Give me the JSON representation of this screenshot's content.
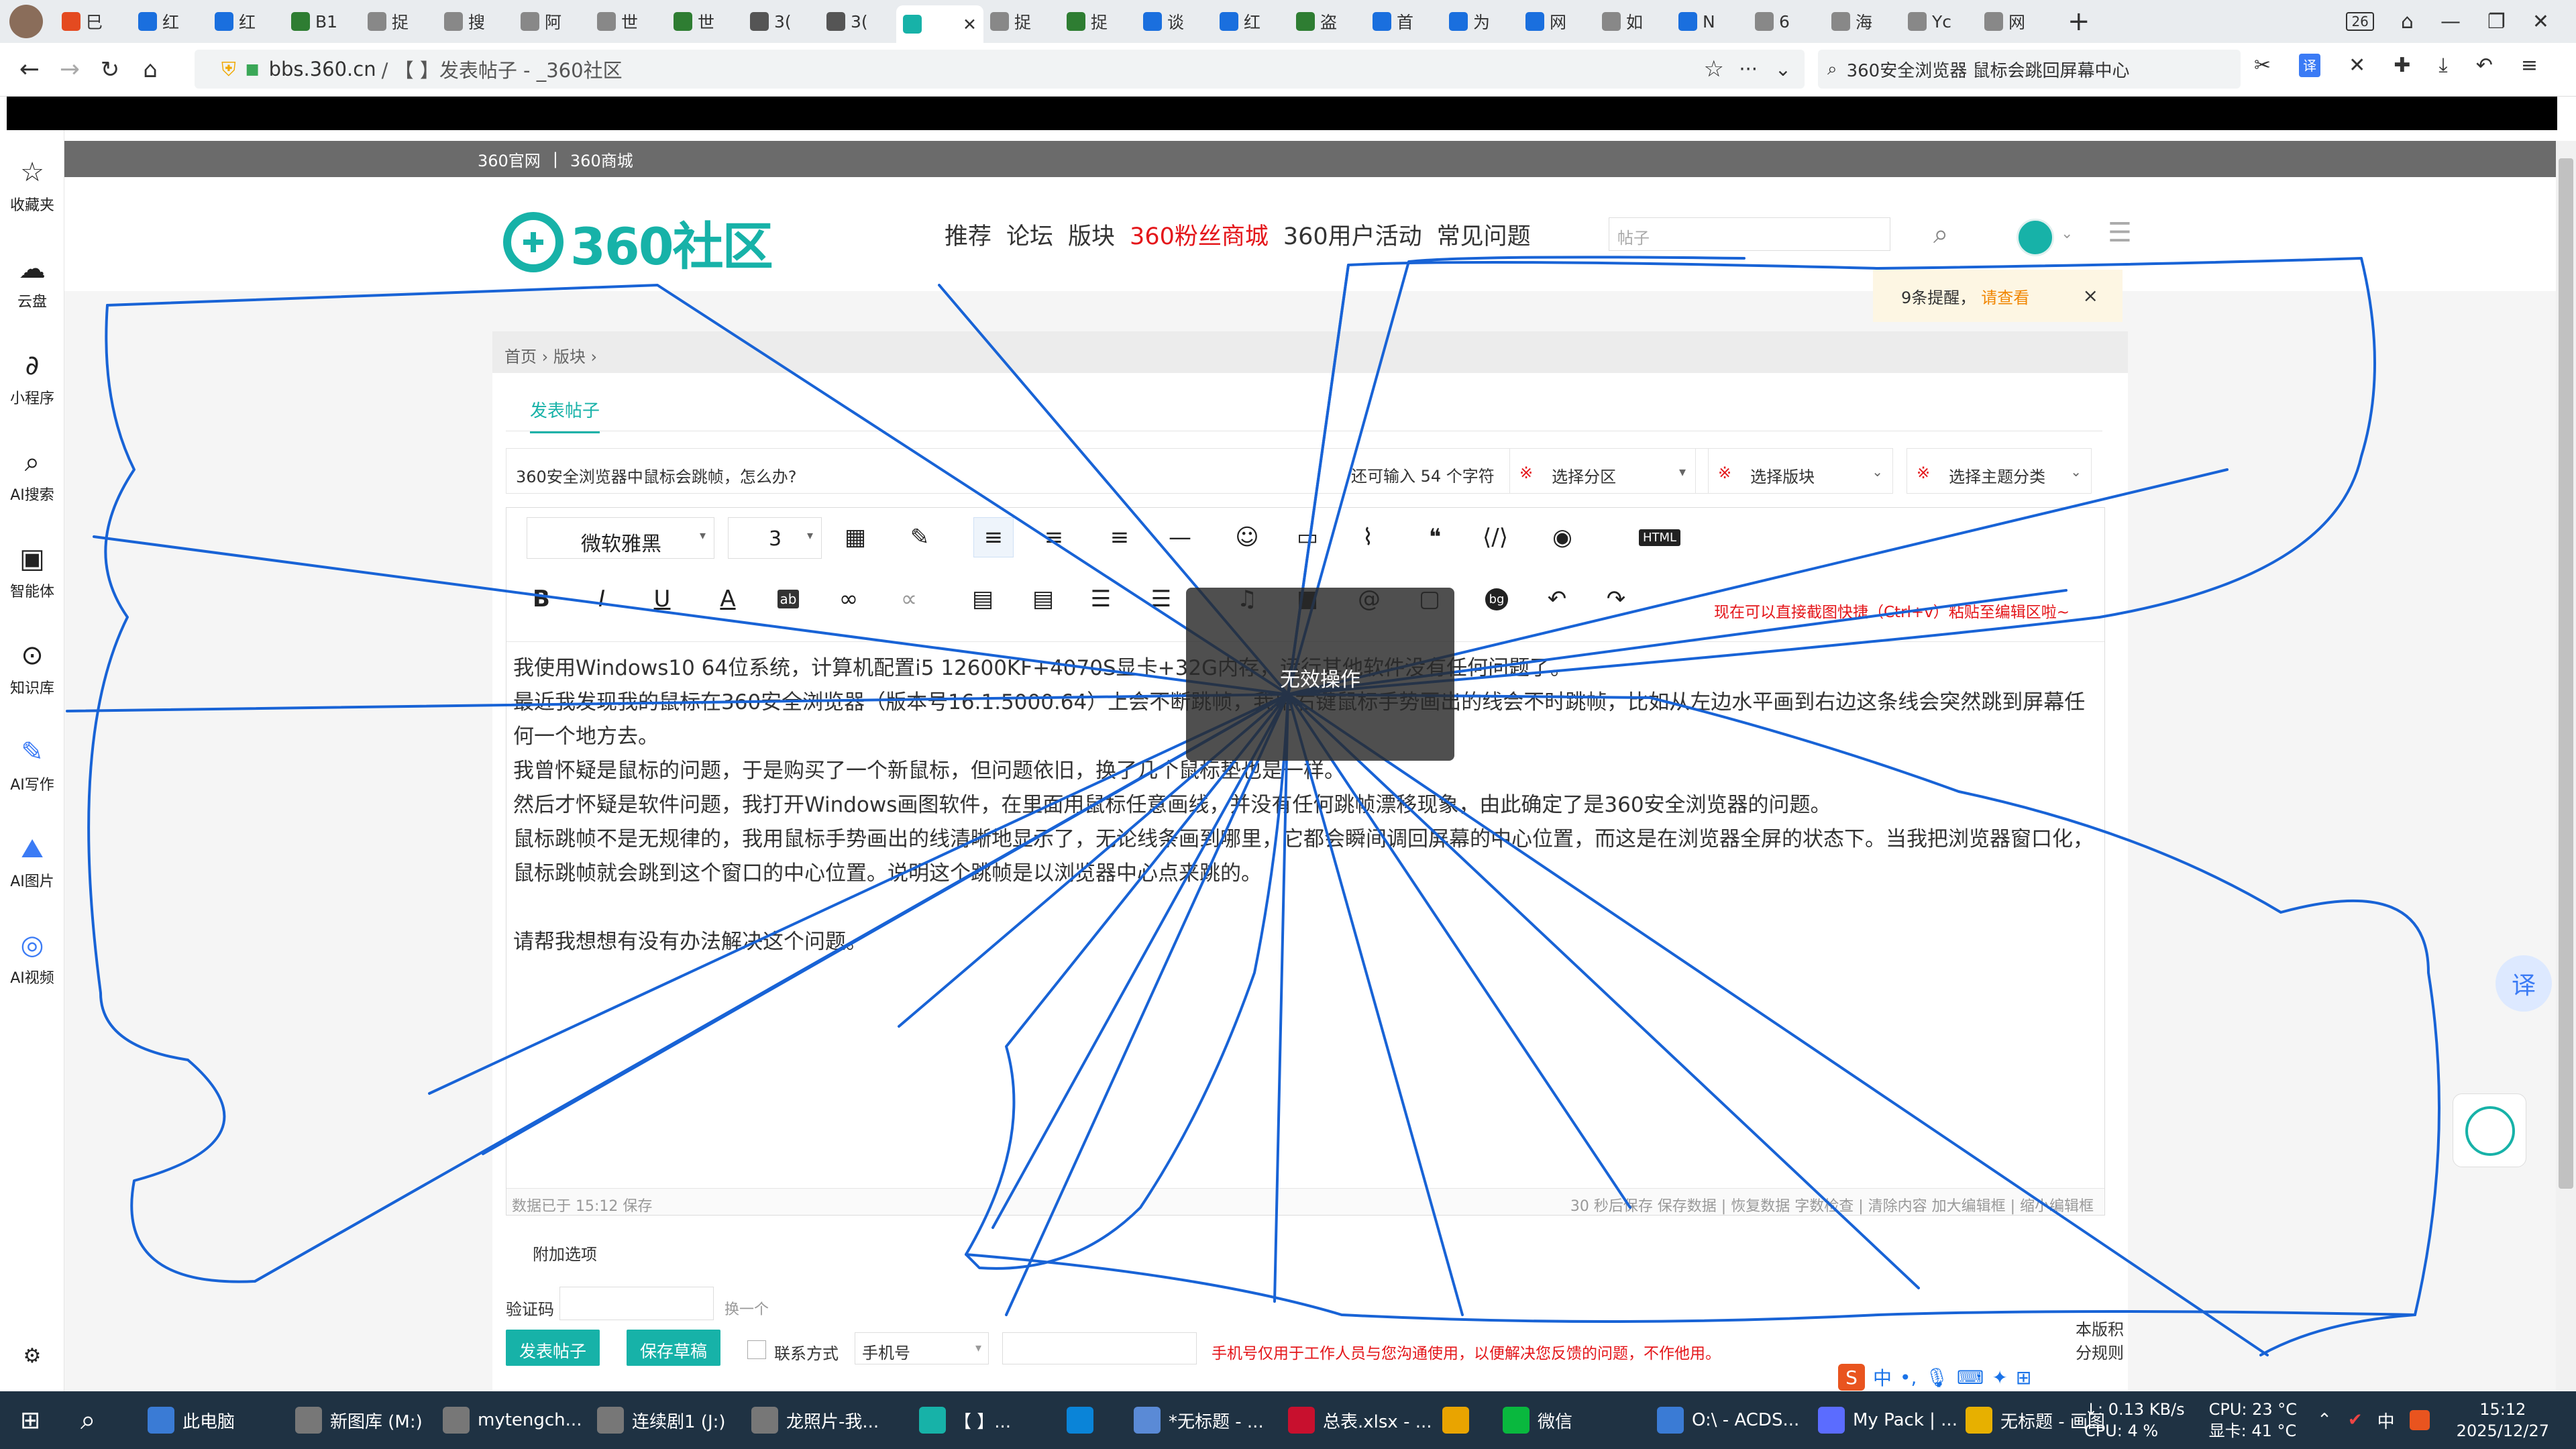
{
  "tabs": [
    {
      "label": "巳",
      "color": "#e44a20"
    },
    {
      "label": "红",
      "color": "#1a6fde"
    },
    {
      "label": "红",
      "color": "#1a6fde"
    },
    {
      "label": "B1",
      "color": "#2e7d32"
    },
    {
      "label": "捉",
      "color": "#888888"
    },
    {
      "label": "搜",
      "color": "#888888"
    },
    {
      "label": "阿",
      "color": "#888888"
    },
    {
      "label": "世",
      "color": "#888888"
    },
    {
      "label": "世",
      "color": "#2e7d32"
    },
    {
      "label": "3(",
      "color": "#555555"
    },
    {
      "label": "3(",
      "color": "#555555"
    },
    {
      "label": "",
      "color": "#17b2a8",
      "active": true
    },
    {
      "label": "捉",
      "color": "#888888"
    },
    {
      "label": "捉",
      "color": "#2e7d32"
    },
    {
      "label": "谈",
      "color": "#1a6fde"
    },
    {
      "label": "红",
      "color": "#1a6fde"
    },
    {
      "label": "盗",
      "color": "#2e7d32"
    },
    {
      "label": "首",
      "color": "#1a6fde"
    },
    {
      "label": "为",
      "color": "#1a6fde"
    },
    {
      "label": "网",
      "color": "#1a6fde"
    },
    {
      "label": "如",
      "color": "#888888"
    },
    {
      "label": "N",
      "color": "#1a6fde"
    },
    {
      "label": "6",
      "color": "#888888"
    },
    {
      "label": "海",
      "color": "#888888"
    },
    {
      "label": "Yc",
      "color": "#888888"
    },
    {
      "label": "网",
      "color": "#888888"
    }
  ],
  "tab_count": "26",
  "url": {
    "domain": "bbs.360.cn",
    "path": "/ 【          】发表帖子 - _360社区"
  },
  "search_box": "360安全浏览器 鼠标会跳回屏幕中心",
  "sidebar": [
    {
      "label": "收藏夹",
      "icon": "star-icon"
    },
    {
      "label": "云盘",
      "icon": "cloud-icon"
    },
    {
      "label": "小程序",
      "icon": "link-icon"
    },
    {
      "label": "AI搜索",
      "icon": "search-icon"
    },
    {
      "label": "智能体",
      "icon": "robot-icon"
    },
    {
      "label": "知识库",
      "icon": "knowledge-icon"
    },
    {
      "label": "AI写作",
      "icon": "pen-icon"
    },
    {
      "label": "AI图片",
      "icon": "image-icon"
    },
    {
      "label": "AI视频",
      "icon": "video-icon"
    }
  ],
  "topstrip": {
    "a": "360官网",
    "sep": "|",
    "b": "360商城"
  },
  "logo": "360社区",
  "nav": [
    "推荐",
    "论坛",
    "版块",
    "360粉丝商城",
    "360用户活动",
    "常见问题"
  ],
  "header_search_placeholder": "帖子",
  "notice": {
    "text": "9条提醒，",
    "link": "请查看",
    "close": "×"
  },
  "breadcrumb": "首页 › 版块 ›",
  "post_tab": "发表帖子",
  "title_value": "360安全浏览器中鼠标会跳帧，怎么办?",
  "remaining": "还可输入 54 个字符",
  "selects": [
    "选择分区",
    "选择版块",
    "选择主题分类"
  ],
  "font": "微软雅黑",
  "fontsize": "3",
  "html_btn": "HTML",
  "paste_hint": "现在可以直接截图快捷（Ctrl+v）粘贴至编辑区啦~",
  "body": [
    "我使用Windows10 64位系统，计算机配置i5 12600KF+4070S显卡+32G内存，运行其他软件没有任何问题了。",
    "最近我发现我的鼠标在360安全浏览器（版本号16.1.5000.64）上会不断跳帧，我用右键鼠标手势画出的线会不时跳帧，比如从左边水平画到右边这条线会突然跳到屏幕任何一个地方去。",
    "我曾怀疑是鼠标的问题，于是购买了一个新鼠标，但问题依旧，换了几个鼠标垫也是一样。",
    "然后才怀疑是软件问题，我打开Windows画图软件，在里面用鼠标任意画线，并没有任何跳帧漂移现象，由此确定了是360安全浏览器的问题。",
    "鼠标跳帧不是无规律的，我用鼠标手势画出的线清晰地显示了，无论线条画到哪里，它都会瞬间调回屏幕的中心位置，而这是在浏览器全屏的状态下。当我把浏览器窗口化，鼠标跳帧就会跳到这个窗口的中心位置。说明这个跳帧是以浏览器中心点来跳的。",
    "",
    "请帮我想想有没有办法解决这个问题。"
  ],
  "status_left": "数据已于 15:12 保存",
  "status_right": "30 秒后保存 保存数据 | 恢复数据   字数检查 | 清除内容   加大编辑框 | 缩小编辑框",
  "attach": "附加选项",
  "captcha_label": "验证码",
  "captcha_refresh": "换一个",
  "submit": "发表帖子",
  "draft": "保存草稿",
  "contact_label": "联系方式",
  "phone_option": "手机号",
  "phone_note": "手机号仅用于工作人员与您沟通使用，以便解决您反馈的问题，不作他用。",
  "rules": "本版积分规则",
  "toast": "无效操作",
  "translate_btn": "译",
  "taskbar": [
    {
      "label": "此电脑",
      "color": "#3a7bd5"
    },
    {
      "label": "新图库 (M:)",
      "color": "#777777"
    },
    {
      "label": "mytengch...",
      "color": "#777777"
    },
    {
      "label": "连续剧1 (J:)",
      "color": "#777777"
    },
    {
      "label": "龙照片-我...",
      "color": "#777777"
    },
    {
      "label": "【          】...",
      "color": "#17b2a8"
    },
    {
      "label": "",
      "color": "#0a84d8"
    },
    {
      "label": "*无标题 - ...",
      "color": "#5a8ad6"
    },
    {
      "label": "总表.xlsx - ...",
      "color": "#c8102e"
    },
    {
      "label": "",
      "color": "#e9a400"
    },
    {
      "label": "微信",
      "color": "#09b83e"
    },
    {
      "label": "O:\\ - ACDS...",
      "color": "#3a7bd5"
    },
    {
      "label": "My Pack | ...",
      "color": "#5b6cff"
    },
    {
      "label": "无标题 - 画图",
      "color": "#e7b000"
    }
  ],
  "net": {
    "down": "↓: 0.13 KB/s",
    "up": "CPU: 4 %"
  },
  "cpu": {
    "temp": "CPU: 23 °C",
    "gpu": "显卡: 41 °C"
  },
  "ime_lang": "中",
  "clock": {
    "time": "15:12",
    "date": "2025/12/27"
  }
}
